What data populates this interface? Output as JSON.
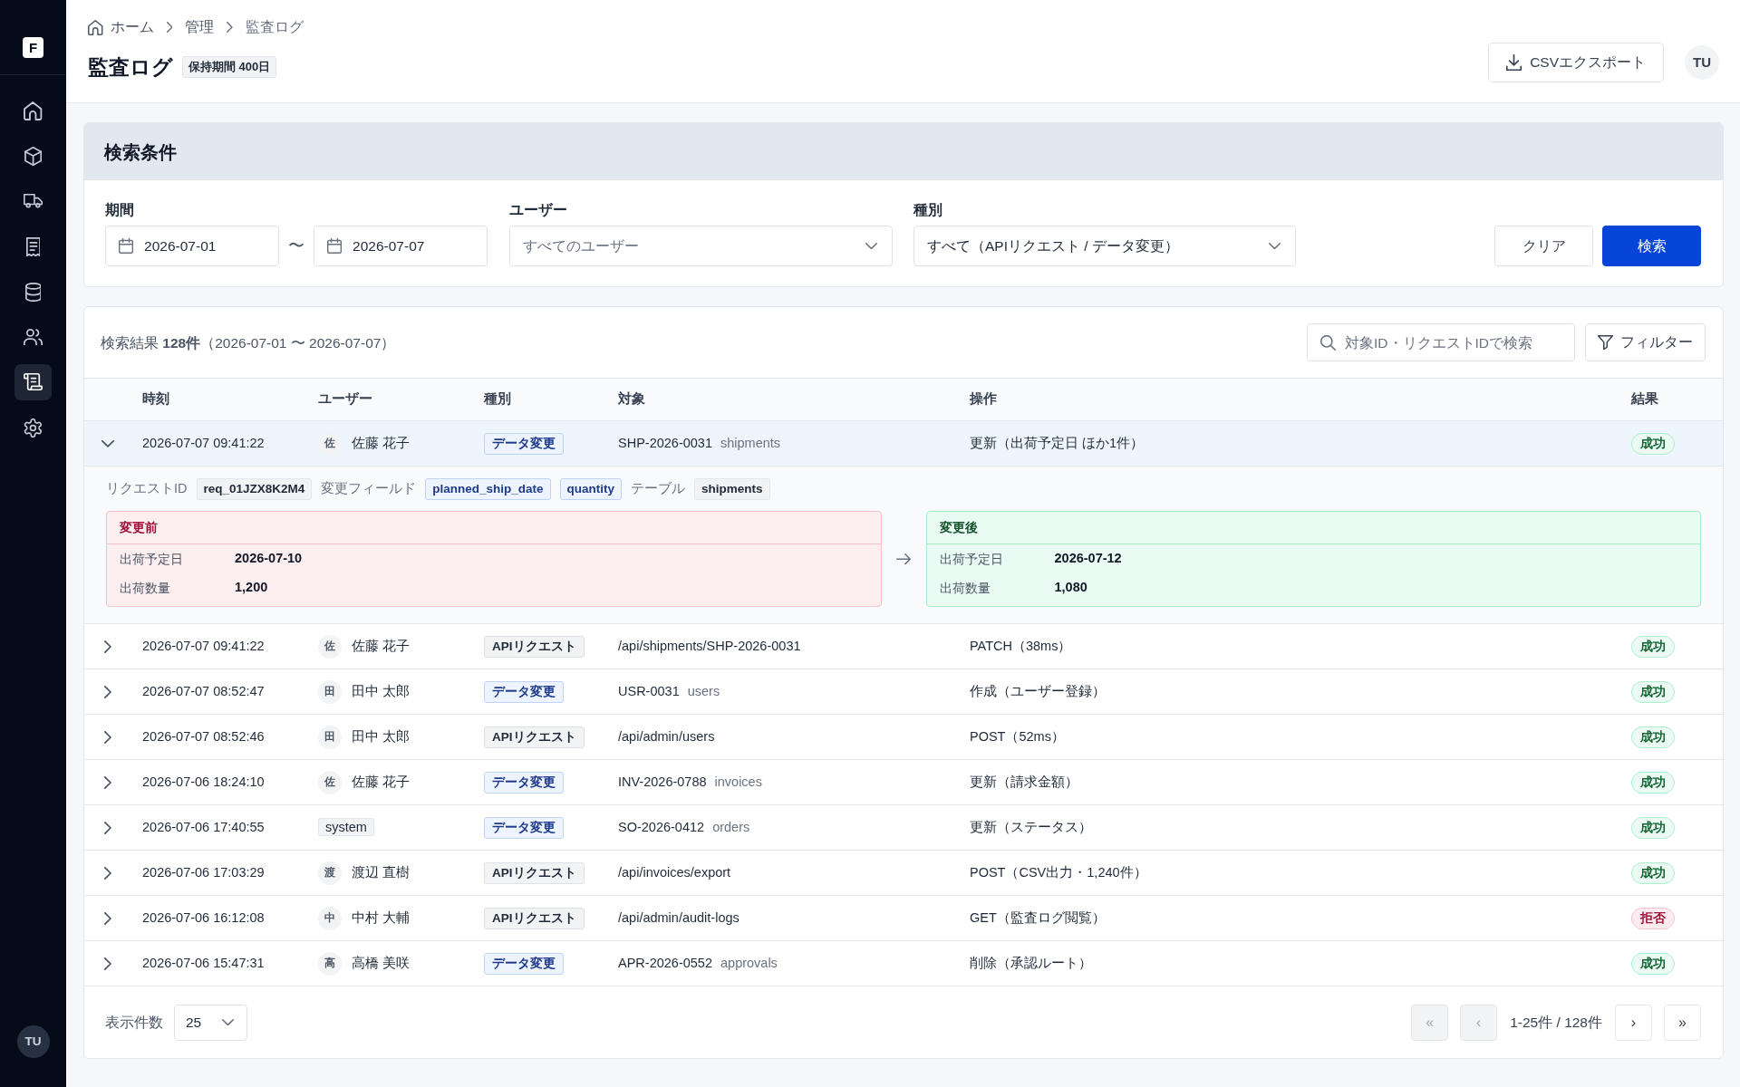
{
  "sidebar": {
    "logo": "F",
    "items": [
      {
        "selected": false
      },
      {
        "selected": false
      },
      {
        "selected": false
      },
      {
        "selected": false
      },
      {
        "selected": false
      },
      {
        "selected": false
      },
      {
        "selected": true
      },
      {
        "selected": false
      }
    ],
    "user_initials": "TU"
  },
  "header": {
    "breadcrumb": [
      "ホーム",
      "管理",
      "監査ログ"
    ],
    "title": "監査ログ",
    "retention_badge": "保持期間 400日",
    "export_button": "CSVエクスポート",
    "user_initials": "TU"
  },
  "search_panel": {
    "title": "検索条件",
    "period": {
      "label": "期間",
      "from": "2026-07-01",
      "separator": "〜",
      "to": "2026-07-07"
    },
    "user": {
      "label": "ユーザー",
      "placeholder": "すべてのユーザー"
    },
    "type": {
      "label": "種別",
      "value": "すべて（APIリクエスト / データ変更）"
    },
    "buttons": [
      {
        "kind": "clear",
        "label": "クリア"
      },
      {
        "kind": "submit",
        "label": "検索"
      }
    ]
  },
  "results": {
    "summary": "検索結果 **128件**（2026-07-01 〜 2026-07-07）",
    "search": {
      "placeholder": "対象ID・リクエストIDで検索"
    },
    "filter_button": "フィルター",
    "table": {
      "columns": [
        "時刻",
        "ユーザー",
        "種別",
        "対象",
        "操作",
        "結果"
      ],
      "rows": [
        {
          "expanded": true,
          "time": "2026-07-07 09:41:22",
          "user": {
            "kind": "person",
            "initial": "佐",
            "name": "佐藤 花子"
          },
          "type": {
            "kind": "data_change",
            "label": "データ変更"
          },
          "target": {
            "id": "SHP-2026-0031",
            "table": "shipments"
          },
          "operation": "更新（出荷予定日 ほか1件）",
          "result": {
            "kind": "success",
            "label": "成功"
          },
          "detail": {
            "request_id": {
              "label": "リクエストID",
              "value": "req_01JZX8K2M4"
            },
            "changed_fields": {
              "label": "変更フィールド",
              "values": [
                "planned_ship_date",
                "quantity"
              ]
            },
            "table": {
              "label": "テーブル",
              "value": "shipments"
            },
            "before": {
              "title": "変更前",
              "rows": [
                {
                  "label": "出荷予定日",
                  "value": "2026-07-10"
                },
                {
                  "label": "出荷数量",
                  "value": "1,200"
                }
              ]
            },
            "after": {
              "title": "変更後",
              "rows": [
                {
                  "label": "出荷予定日",
                  "value": "2026-07-12"
                },
                {
                  "label": "出荷数量",
                  "value": "1,080"
                }
              ]
            }
          }
        },
        {
          "expanded": false,
          "time": "2026-07-07 09:41:22",
          "user": {
            "kind": "person",
            "initial": "佐",
            "name": "佐藤 花子"
          },
          "type": {
            "kind": "api_request",
            "label": "APIリクエスト"
          },
          "target": {
            "id": "/api/shipments/SHP-2026-0031"
          },
          "operation": "PATCH（38ms）",
          "result": {
            "kind": "success",
            "label": "成功"
          }
        },
        {
          "expanded": false,
          "time": "2026-07-07 08:52:47",
          "user": {
            "kind": "person",
            "initial": "田",
            "name": "田中 太郎"
          },
          "type": {
            "kind": "data_change",
            "label": "データ変更"
          },
          "target": {
            "id": "USR-0031",
            "table": "users"
          },
          "operation": "作成（ユーザー登録）",
          "result": {
            "kind": "success",
            "label": "成功"
          }
        },
        {
          "expanded": false,
          "time": "2026-07-07 08:52:46",
          "user": {
            "kind": "person",
            "initial": "田",
            "name": "田中 太郎"
          },
          "type": {
            "kind": "api_request",
            "label": "APIリクエスト"
          },
          "target": {
            "id": "/api/admin/users"
          },
          "operation": "POST（52ms）",
          "result": {
            "kind": "success",
            "label": "成功"
          }
        },
        {
          "expanded": false,
          "time": "2026-07-06 18:24:10",
          "user": {
            "kind": "person",
            "initial": "佐",
            "name": "佐藤 花子"
          },
          "type": {
            "kind": "data_change",
            "label": "データ変更"
          },
          "target": {
            "id": "INV-2026-0788",
            "table": "invoices"
          },
          "operation": "更新（請求金額）",
          "result": {
            "kind": "success",
            "label": "成功"
          }
        },
        {
          "expanded": false,
          "time": "2026-07-06 17:40:55",
          "user": {
            "kind": "system",
            "name": "system"
          },
          "type": {
            "kind": "data_change",
            "label": "データ変更"
          },
          "target": {
            "id": "SO-2026-0412",
            "table": "orders"
          },
          "operation": "更新（ステータス）",
          "result": {
            "kind": "success",
            "label": "成功"
          }
        },
        {
          "expanded": false,
          "time": "2026-07-06 17:03:29",
          "user": {
            "kind": "person",
            "initial": "渡",
            "name": "渡辺 直樹"
          },
          "type": {
            "kind": "api_request",
            "label": "APIリクエスト"
          },
          "target": {
            "id": "/api/invoices/export"
          },
          "operation": "POST（CSV出力・1,240件）",
          "result": {
            "kind": "success",
            "label": "成功"
          }
        },
        {
          "expanded": false,
          "time": "2026-07-06 16:12:08",
          "user": {
            "kind": "person",
            "initial": "中",
            "name": "中村 大輔"
          },
          "type": {
            "kind": "api_request",
            "label": "APIリクエスト"
          },
          "target": {
            "id": "/api/admin/audit-logs"
          },
          "operation": "GET（監査ログ閲覧）",
          "result": {
            "kind": "denied",
            "label": "拒否"
          }
        },
        {
          "expanded": false,
          "time": "2026-07-06 15:47:31",
          "user": {
            "kind": "person",
            "initial": "高",
            "name": "高橋 美咲"
          },
          "type": {
            "kind": "data_change",
            "label": "データ変更"
          },
          "target": {
            "id": "APR-2026-0552",
            "table": "approvals"
          },
          "operation": "削除（承認ルート）",
          "result": {
            "kind": "success",
            "label": "成功"
          }
        }
      ]
    },
    "per_page": {
      "label": "表示件数",
      "value": "25"
    },
    "pagination": {
      "first": {
        "label": "«",
        "disabled": true
      },
      "previous": {
        "label": "‹",
        "disabled": true
      },
      "range": "1-25件 / 128件",
      "next": {
        "label": "›",
        "disabled": false
      },
      "last": {
        "label": "»",
        "disabled": false
      }
    }
  }
}
